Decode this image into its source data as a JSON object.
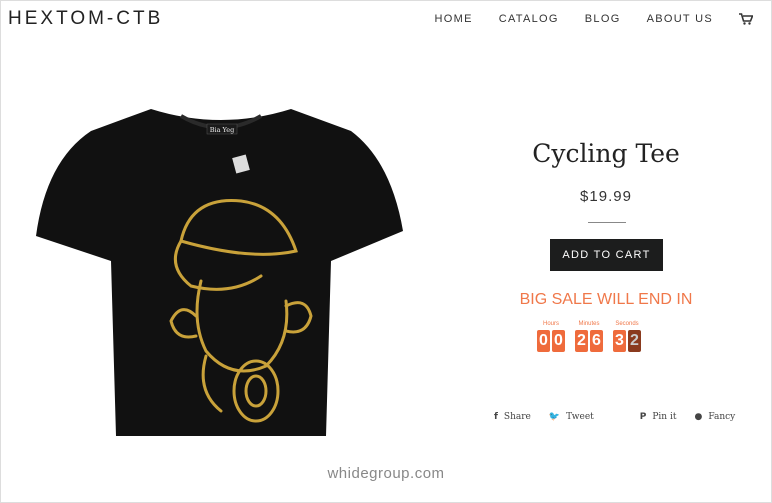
{
  "header": {
    "logo": "HEXTOM-CTB",
    "nav": [
      "HOME",
      "CATALOG",
      "BLOG",
      "ABOUT US"
    ],
    "cart_icon": "cart-icon"
  },
  "product": {
    "title": "Cycling Tee",
    "price": "$19.99",
    "add_to_cart": "ADD TO CART",
    "tag_label": "Bia Yeg"
  },
  "countdown": {
    "heading": "BIG SALE WILL END IN",
    "labels": [
      "Hours",
      "Minutes",
      "Seconds"
    ],
    "hours": [
      "0",
      "0"
    ],
    "minutes": [
      "2",
      "6"
    ],
    "seconds": [
      "3",
      "2"
    ],
    "color": "#f0784a"
  },
  "share": [
    {
      "icon": "facebook-icon",
      "glyph": "f",
      "label": "Share"
    },
    {
      "icon": "twitter-icon",
      "glyph": "🐦",
      "label": "Tweet"
    },
    {
      "icon": "pinterest-icon",
      "glyph": "P",
      "label": "Pin it"
    },
    {
      "icon": "fancy-icon",
      "glyph": "●",
      "label": "Fancy"
    }
  ],
  "footer": "whidegroup.com"
}
